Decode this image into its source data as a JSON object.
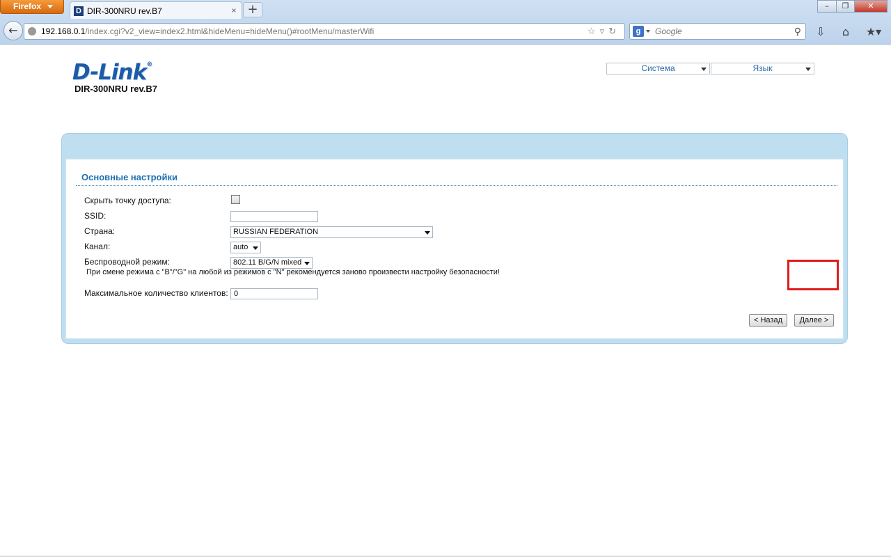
{
  "browser": {
    "app_button": "Firefox",
    "tab_title": "DIR-300NRU rev.B7",
    "favicon_letter": "D",
    "tab_close": "×",
    "new_tab": "+",
    "url_host": "192.168.0.1",
    "url_path": "/index.cgi?v2_view=index2.html&hideMenu=hideMenu()#rootMenu/masterWifi",
    "search_placeholder": "Google",
    "search_engine_letter": "g"
  },
  "header": {
    "logo": "D-Link",
    "logo_mark": "®",
    "model": "DIR-300NRU rev.B7",
    "menu_system": "Система",
    "menu_language": "Язык"
  },
  "form": {
    "section_title": "Основные настройки",
    "hide_ap_label": "Скрыть точку доступа:",
    "ssid_label": "SSID:",
    "ssid_value": "",
    "country_label": "Страна:",
    "country_value": "RUSSIAN FEDERATION",
    "channel_label": "Канал:",
    "channel_value": "auto",
    "mode_label": "Беспроводной режим:",
    "mode_value": "802.11 B/G/N mixed",
    "mode_note": "При смене режима с \"B\"/\"G\" на любой из режимов с \"N\" рекомендуется заново произвести настройку безопасности!",
    "max_clients_label": "Максимальное количество клиентов:",
    "max_clients_value": "0",
    "back_button": "< Назад",
    "next_button": "Далее >"
  }
}
